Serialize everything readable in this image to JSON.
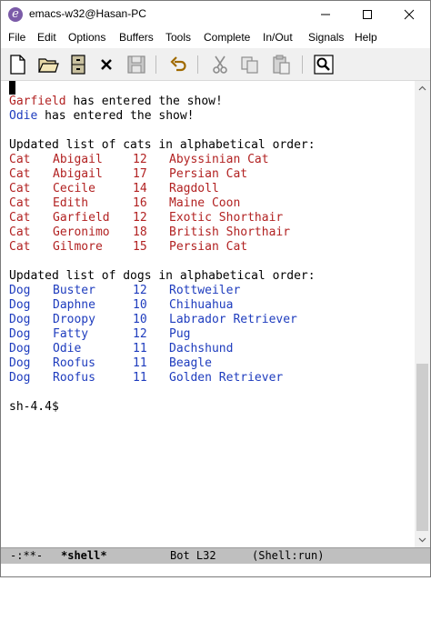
{
  "window": {
    "title": "emacs-w32@Hasan-PC"
  },
  "menubar": {
    "items": [
      "File",
      "Edit",
      "Options",
      "Buffers",
      "Tools",
      "Complete",
      "In/Out",
      "Signals",
      "Help"
    ]
  },
  "toolbar": {
    "buttons": [
      "new-file-icon",
      "open-folder-icon",
      "file-cabinet-icon",
      "close-icon",
      "save-icon",
      "undo-icon",
      "cut-icon",
      "copy-icon",
      "paste-icon",
      "search-icon"
    ]
  },
  "colors": {
    "cat": "#b22222",
    "dog": "#1e3cbe",
    "modeline_bg": "#bfbfbf"
  },
  "buffer": {
    "entered": [
      {
        "name": "Garfield",
        "text": " has entered the show!"
      },
      {
        "name": "Odie",
        "text": " has entered the show!"
      }
    ],
    "cats_header": "Updated list of cats in alphabetical order:",
    "cats": [
      {
        "type": "Cat",
        "name": "Abigail",
        "age": "12",
        "breed": "Abyssinian Cat"
      },
      {
        "type": "Cat",
        "name": "Abigail",
        "age": "17",
        "breed": "Persian Cat"
      },
      {
        "type": "Cat",
        "name": "Cecile",
        "age": "14",
        "breed": "Ragdoll"
      },
      {
        "type": "Cat",
        "name": "Edith",
        "age": "16",
        "breed": "Maine Coon"
      },
      {
        "type": "Cat",
        "name": "Garfield",
        "age": "12",
        "breed": "Exotic Shorthair"
      },
      {
        "type": "Cat",
        "name": "Geronimo",
        "age": "18",
        "breed": "British Shorthair"
      },
      {
        "type": "Cat",
        "name": "Gilmore",
        "age": "15",
        "breed": "Persian Cat"
      }
    ],
    "dogs_header": "Updated list of dogs in alphabetical order:",
    "dogs": [
      {
        "type": "Dog",
        "name": "Buster",
        "age": "12",
        "breed": "Rottweiler"
      },
      {
        "type": "Dog",
        "name": "Daphne",
        "age": "10",
        "breed": "Chihuahua"
      },
      {
        "type": "Dog",
        "name": "Droopy",
        "age": "10",
        "breed": "Labrador Retriever"
      },
      {
        "type": "Dog",
        "name": "Fatty",
        "age": "12",
        "breed": "Pug"
      },
      {
        "type": "Dog",
        "name": "Odie",
        "age": "11",
        "breed": "Dachshund"
      },
      {
        "type": "Dog",
        "name": "Roofus",
        "age": "11",
        "breed": "Beagle"
      },
      {
        "type": "Dog",
        "name": "Roofus",
        "age": "11",
        "breed": "Golden Retriever"
      }
    ],
    "prompt": "sh-4.4$"
  },
  "modeline": {
    "status": "-:**-",
    "buffer_name": "*shell*",
    "position": "Bot L32",
    "mode": "(Shell:run)"
  }
}
